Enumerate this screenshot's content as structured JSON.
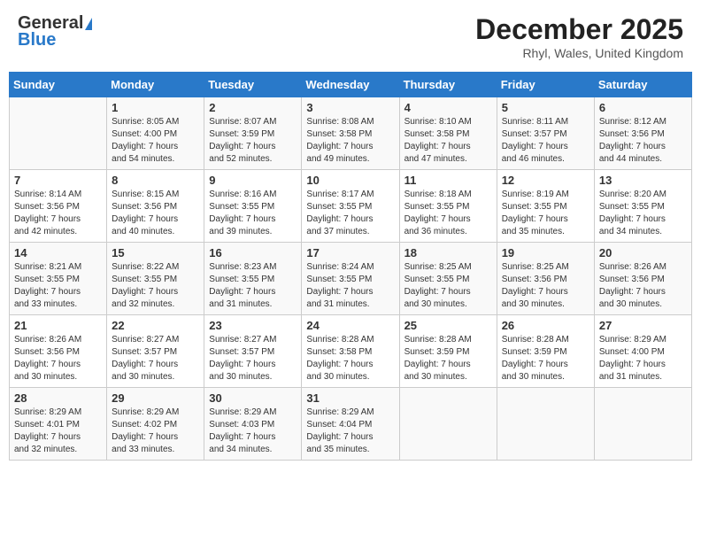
{
  "header": {
    "logo_general": "General",
    "logo_blue": "Blue",
    "month_title": "December 2025",
    "location": "Rhyl, Wales, United Kingdom"
  },
  "weekdays": [
    "Sunday",
    "Monday",
    "Tuesday",
    "Wednesday",
    "Thursday",
    "Friday",
    "Saturday"
  ],
  "weeks": [
    [
      {
        "day": "",
        "content": ""
      },
      {
        "day": "1",
        "content": "Sunrise: 8:05 AM\nSunset: 4:00 PM\nDaylight: 7 hours\nand 54 minutes."
      },
      {
        "day": "2",
        "content": "Sunrise: 8:07 AM\nSunset: 3:59 PM\nDaylight: 7 hours\nand 52 minutes."
      },
      {
        "day": "3",
        "content": "Sunrise: 8:08 AM\nSunset: 3:58 PM\nDaylight: 7 hours\nand 49 minutes."
      },
      {
        "day": "4",
        "content": "Sunrise: 8:10 AM\nSunset: 3:58 PM\nDaylight: 7 hours\nand 47 minutes."
      },
      {
        "day": "5",
        "content": "Sunrise: 8:11 AM\nSunset: 3:57 PM\nDaylight: 7 hours\nand 46 minutes."
      },
      {
        "day": "6",
        "content": "Sunrise: 8:12 AM\nSunset: 3:56 PM\nDaylight: 7 hours\nand 44 minutes."
      }
    ],
    [
      {
        "day": "7",
        "content": "Sunrise: 8:14 AM\nSunset: 3:56 PM\nDaylight: 7 hours\nand 42 minutes."
      },
      {
        "day": "8",
        "content": "Sunrise: 8:15 AM\nSunset: 3:56 PM\nDaylight: 7 hours\nand 40 minutes."
      },
      {
        "day": "9",
        "content": "Sunrise: 8:16 AM\nSunset: 3:55 PM\nDaylight: 7 hours\nand 39 minutes."
      },
      {
        "day": "10",
        "content": "Sunrise: 8:17 AM\nSunset: 3:55 PM\nDaylight: 7 hours\nand 37 minutes."
      },
      {
        "day": "11",
        "content": "Sunrise: 8:18 AM\nSunset: 3:55 PM\nDaylight: 7 hours\nand 36 minutes."
      },
      {
        "day": "12",
        "content": "Sunrise: 8:19 AM\nSunset: 3:55 PM\nDaylight: 7 hours\nand 35 minutes."
      },
      {
        "day": "13",
        "content": "Sunrise: 8:20 AM\nSunset: 3:55 PM\nDaylight: 7 hours\nand 34 minutes."
      }
    ],
    [
      {
        "day": "14",
        "content": "Sunrise: 8:21 AM\nSunset: 3:55 PM\nDaylight: 7 hours\nand 33 minutes."
      },
      {
        "day": "15",
        "content": "Sunrise: 8:22 AM\nSunset: 3:55 PM\nDaylight: 7 hours\nand 32 minutes."
      },
      {
        "day": "16",
        "content": "Sunrise: 8:23 AM\nSunset: 3:55 PM\nDaylight: 7 hours\nand 31 minutes."
      },
      {
        "day": "17",
        "content": "Sunrise: 8:24 AM\nSunset: 3:55 PM\nDaylight: 7 hours\nand 31 minutes."
      },
      {
        "day": "18",
        "content": "Sunrise: 8:25 AM\nSunset: 3:55 PM\nDaylight: 7 hours\nand 30 minutes."
      },
      {
        "day": "19",
        "content": "Sunrise: 8:25 AM\nSunset: 3:56 PM\nDaylight: 7 hours\nand 30 minutes."
      },
      {
        "day": "20",
        "content": "Sunrise: 8:26 AM\nSunset: 3:56 PM\nDaylight: 7 hours\nand 30 minutes."
      }
    ],
    [
      {
        "day": "21",
        "content": "Sunrise: 8:26 AM\nSunset: 3:56 PM\nDaylight: 7 hours\nand 30 minutes."
      },
      {
        "day": "22",
        "content": "Sunrise: 8:27 AM\nSunset: 3:57 PM\nDaylight: 7 hours\nand 30 minutes."
      },
      {
        "day": "23",
        "content": "Sunrise: 8:27 AM\nSunset: 3:57 PM\nDaylight: 7 hours\nand 30 minutes."
      },
      {
        "day": "24",
        "content": "Sunrise: 8:28 AM\nSunset: 3:58 PM\nDaylight: 7 hours\nand 30 minutes."
      },
      {
        "day": "25",
        "content": "Sunrise: 8:28 AM\nSunset: 3:59 PM\nDaylight: 7 hours\nand 30 minutes."
      },
      {
        "day": "26",
        "content": "Sunrise: 8:28 AM\nSunset: 3:59 PM\nDaylight: 7 hours\nand 30 minutes."
      },
      {
        "day": "27",
        "content": "Sunrise: 8:29 AM\nSunset: 4:00 PM\nDaylight: 7 hours\nand 31 minutes."
      }
    ],
    [
      {
        "day": "28",
        "content": "Sunrise: 8:29 AM\nSunset: 4:01 PM\nDaylight: 7 hours\nand 32 minutes."
      },
      {
        "day": "29",
        "content": "Sunrise: 8:29 AM\nSunset: 4:02 PM\nDaylight: 7 hours\nand 33 minutes."
      },
      {
        "day": "30",
        "content": "Sunrise: 8:29 AM\nSunset: 4:03 PM\nDaylight: 7 hours\nand 34 minutes."
      },
      {
        "day": "31",
        "content": "Sunrise: 8:29 AM\nSunset: 4:04 PM\nDaylight: 7 hours\nand 35 minutes."
      },
      {
        "day": "",
        "content": ""
      },
      {
        "day": "",
        "content": ""
      },
      {
        "day": "",
        "content": ""
      }
    ]
  ]
}
